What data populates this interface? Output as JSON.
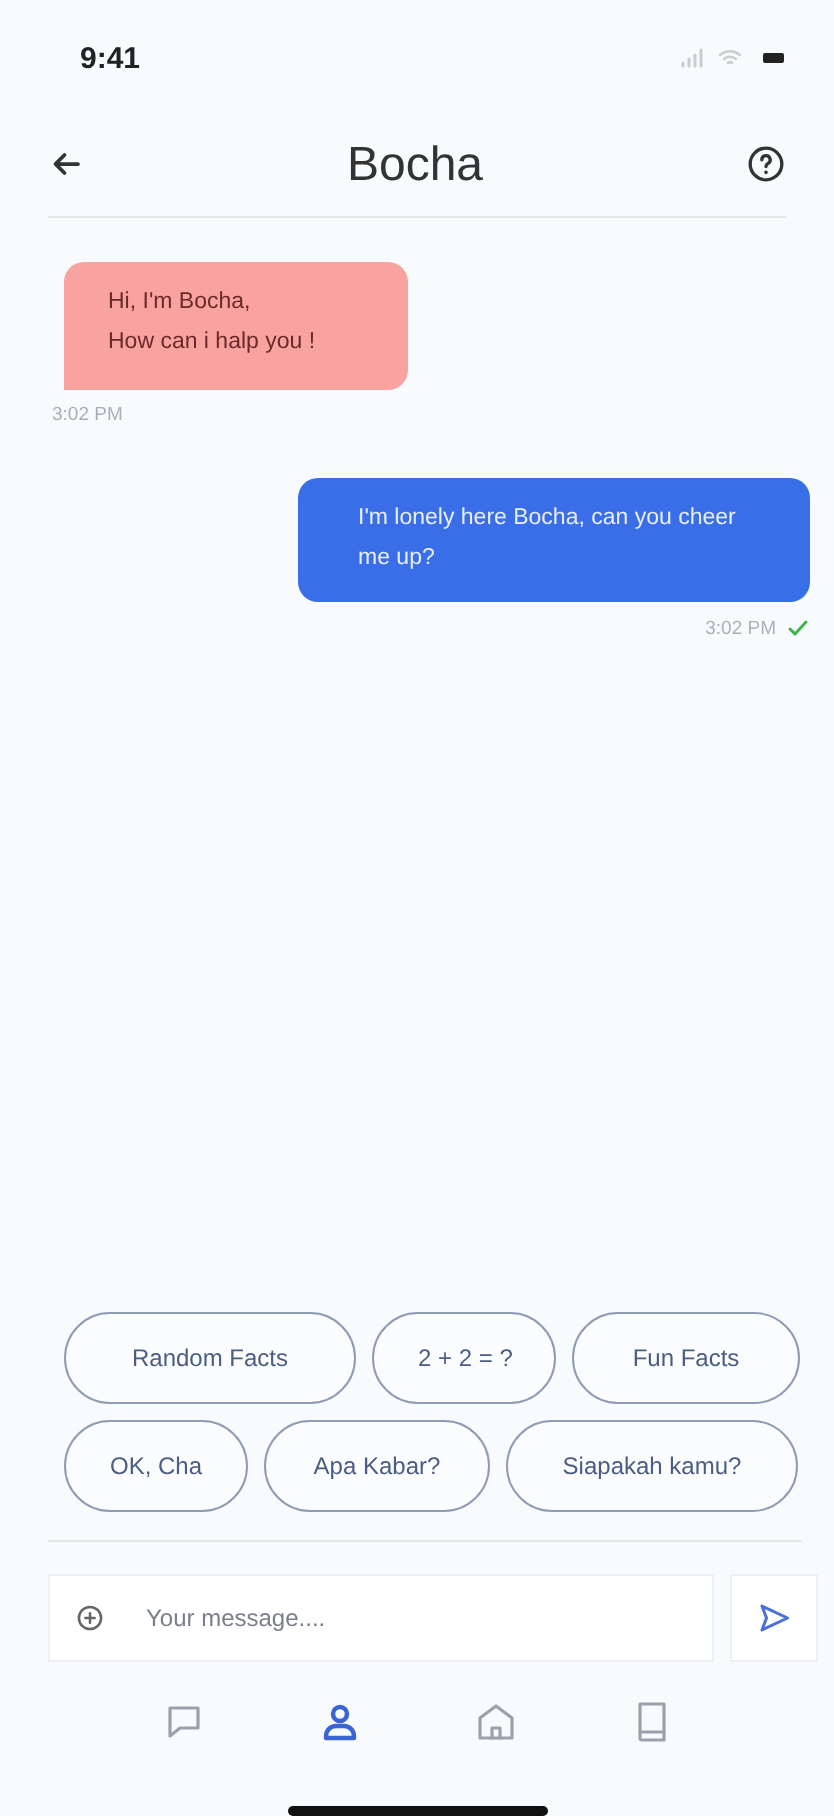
{
  "status_bar": {
    "time": "9:41"
  },
  "header": {
    "title": "Bocha"
  },
  "messages": [
    {
      "kind": "bot",
      "lines": [
        "Hi, I'm Bocha,",
        "How can i halp you !"
      ],
      "time": "3:02 PM",
      "delivered": false
    },
    {
      "kind": "user",
      "lines": [
        "I'm lonely here Bocha, can you cheer me up?"
      ],
      "time": "3:02 PM",
      "delivered": true
    }
  ],
  "quick_replies": [
    [
      "Random Facts",
      "2 + 2 = ?",
      "Fun Facts"
    ],
    [
      "OK, Cha",
      "Apa Kabar?",
      "Siapakah kamu?"
    ]
  ],
  "composer": {
    "placeholder": "Your message...."
  },
  "nav": [
    {
      "kind": "chat",
      "selected": false
    },
    {
      "kind": "profile",
      "selected": true
    },
    {
      "kind": "home",
      "selected": false
    },
    {
      "kind": "book",
      "selected": false
    }
  ]
}
